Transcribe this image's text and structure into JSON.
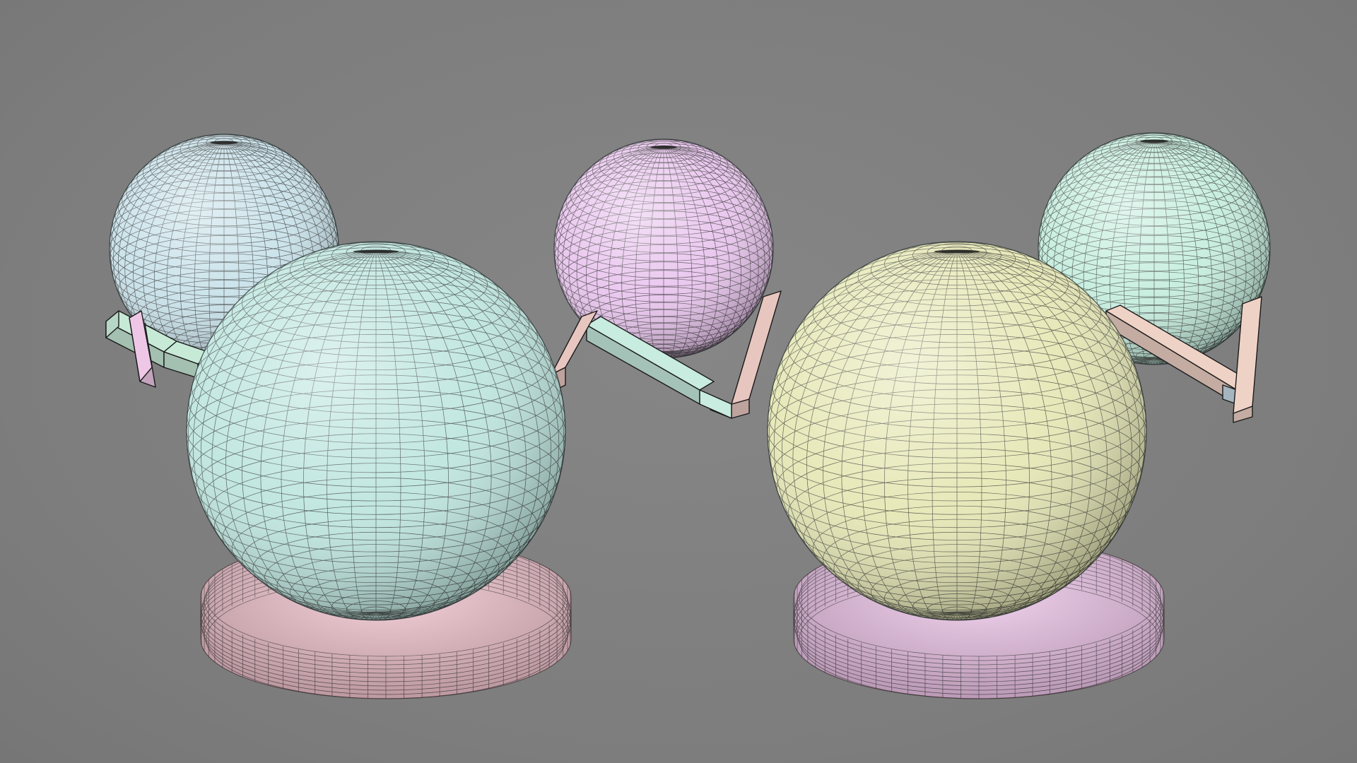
{
  "viewport": {
    "background": "#808080",
    "wireframe_color": "#2b2b2b"
  },
  "scene": {
    "objects": [
      {
        "name": "sphere-back-left",
        "type": "uv-sphere",
        "color": "#c9e2ea"
      },
      {
        "name": "bracket-back-left",
        "type": "l-bracket",
        "colors": [
          "#c7ead7",
          "#eec7e6"
        ]
      },
      {
        "name": "sphere-front-left",
        "type": "uv-sphere",
        "color": "#bfe6df"
      },
      {
        "name": "torus-front-left",
        "type": "torus",
        "color": "#f2c4cf"
      },
      {
        "name": "sphere-back-middle",
        "type": "uv-sphere",
        "color": "#e9c6ee"
      },
      {
        "name": "bracket-back-middle",
        "type": "l-bracket",
        "colors": [
          "#c8ecdf",
          "#e8c6c0"
        ]
      },
      {
        "name": "sphere-front-right",
        "type": "uv-sphere",
        "color": "#e6e8b6"
      },
      {
        "name": "torus-front-right",
        "type": "torus",
        "color": "#efc6ea"
      },
      {
        "name": "sphere-back-right",
        "type": "uv-sphere",
        "color": "#c6eedf"
      },
      {
        "name": "bracket-back-right",
        "type": "l-bracket",
        "colors": [
          "#efd2c6",
          "#c9dde9"
        ]
      }
    ]
  }
}
